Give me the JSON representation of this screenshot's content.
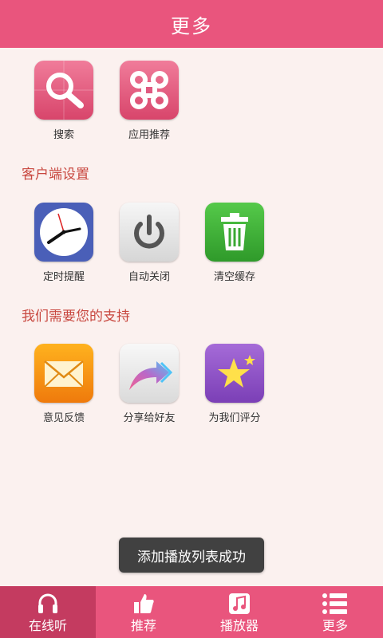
{
  "header": {
    "title": "更多"
  },
  "top_apps": [
    {
      "label": "搜索",
      "icon": "search-icon"
    },
    {
      "label": "应用推荐",
      "icon": "command-icon"
    }
  ],
  "sections": [
    {
      "title": "客户端设置",
      "items": [
        {
          "label": "定时提醒",
          "icon": "clock-icon"
        },
        {
          "label": "自动关闭",
          "icon": "power-icon"
        },
        {
          "label": "清空缓存",
          "icon": "trash-icon"
        }
      ]
    },
    {
      "title": "我们需要您的支持",
      "items": [
        {
          "label": "意见反馈",
          "icon": "mail-icon"
        },
        {
          "label": "分享给好友",
          "icon": "share-arrow-icon"
        },
        {
          "label": "为我们评分",
          "icon": "star-icon"
        }
      ]
    }
  ],
  "toast": {
    "text": "添加播放列表成功"
  },
  "tabbar": [
    {
      "label": "在线听",
      "icon": "headphones-icon",
      "active": true
    },
    {
      "label": "推荐",
      "icon": "thumbs-up-icon",
      "active": false
    },
    {
      "label": "播放器",
      "icon": "music-note-icon",
      "active": false
    },
    {
      "label": "更多",
      "icon": "list-icon",
      "active": false
    }
  ],
  "colors": {
    "accent": "#e9557d",
    "active_tab": "#c43b60",
    "section_title": "#c8473f",
    "background": "#fbf1ef"
  }
}
